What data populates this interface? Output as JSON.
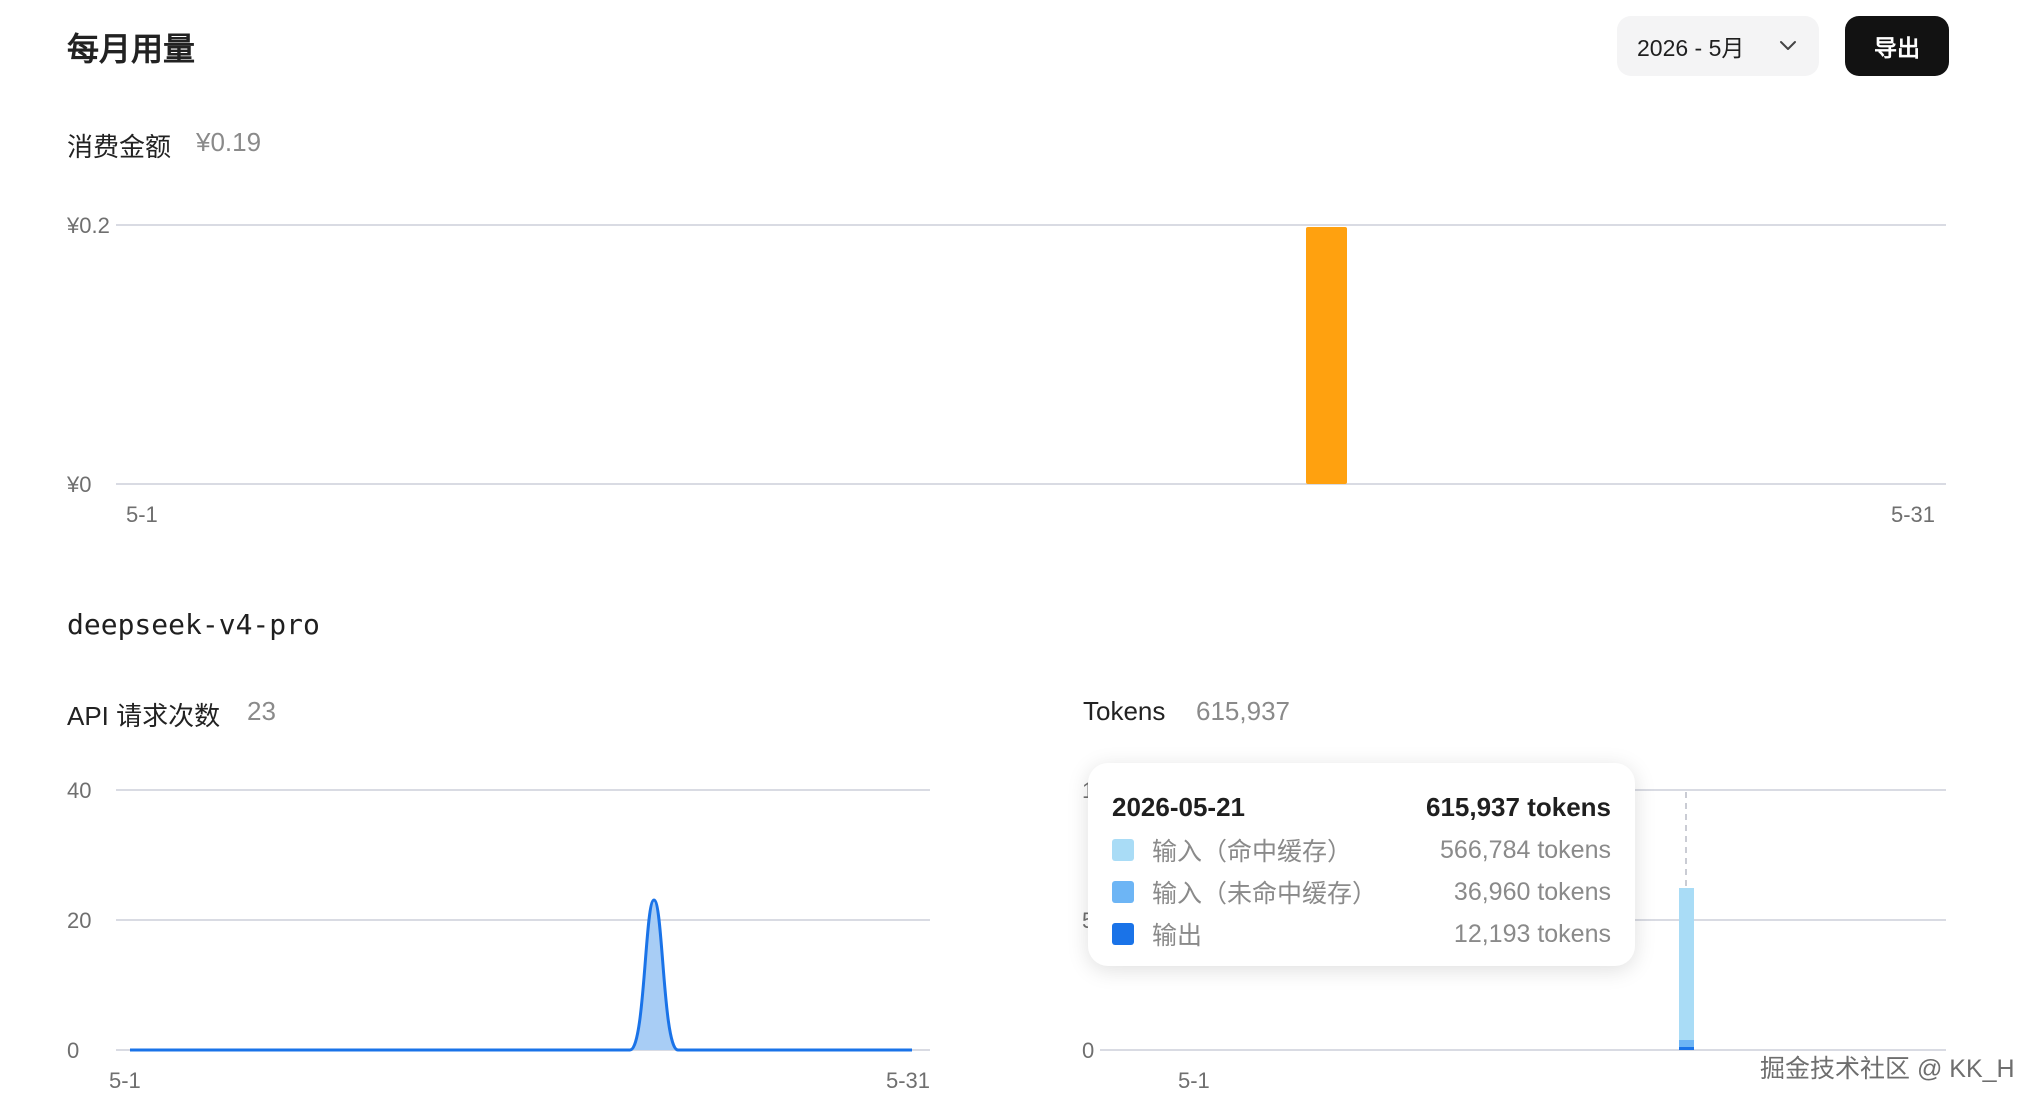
{
  "header": {
    "title": "每月用量",
    "month_value": "2026 - 5月",
    "export_label": "导出"
  },
  "cost": {
    "label": "消费金额",
    "total": "¥0.19"
  },
  "model": {
    "name": "deepseek-v4-pro"
  },
  "requests": {
    "label": "API 请求次数",
    "total": "23"
  },
  "tokens": {
    "label": "Tokens",
    "total": "615,937"
  },
  "tooltip": {
    "date": "2026-05-21",
    "total": "615,937 tokens",
    "rows": [
      {
        "label": "输入（命中缓存）",
        "value": "566,784 tokens",
        "color": "#a9dcf6"
      },
      {
        "label": "输入（未命中缓存）",
        "value": "36,960 tokens",
        "color": "#6db5f5"
      },
      {
        "label": "输出",
        "value": "12,193 tokens",
        "color": "#1a73e8"
      }
    ]
  },
  "watermark": "掘金技术社区 @ KK_H",
  "colors": {
    "cost_bar": "#ffa10f",
    "requests_line": "#1a73e8",
    "requests_fill": "#a8cdf5",
    "grid": "#d9dbe3"
  },
  "chart_data": [
    {
      "type": "bar",
      "x": [
        "5-21"
      ],
      "values": [
        0.19
      ],
      "ytick_labels": [
        "¥0",
        "¥0.2"
      ],
      "xtick_labels": [
        "5-1",
        "5-31"
      ],
      "x_range": [
        "5-1",
        "5-31"
      ],
      "ylim": [
        0,
        0.2
      ],
      "grid": true,
      "color": "#ffa10f"
    },
    {
      "type": "area",
      "x": [
        "5-1",
        "5-20",
        "5-21",
        "5-22",
        "5-31"
      ],
      "values": [
        0,
        0,
        23,
        0,
        0
      ],
      "ytick_labels": [
        "0",
        "20",
        "40"
      ],
      "xtick_labels": [
        "5-1",
        "5-31"
      ],
      "ylim": [
        0,
        40
      ],
      "grid": true,
      "color": "#1a73e8"
    },
    {
      "type": "bar",
      "x": [
        "5-21"
      ],
      "series": [
        {
          "name": "输出",
          "values": [
            12193
          ],
          "color": "#1a73e8"
        },
        {
          "name": "输入（未命中缓存）",
          "values": [
            36960
          ],
          "color": "#6db5f5"
        },
        {
          "name": "输入（命中缓存）",
          "values": [
            566784
          ],
          "color": "#a9dcf6"
        }
      ],
      "stacked": true,
      "ytick_labels_visible": [
        "0",
        "5",
        "1,"
      ],
      "xtick_labels": [
        "5-1"
      ],
      "ylim": [
        0,
        1000000
      ],
      "grid": true,
      "highlight": "5-21"
    }
  ]
}
